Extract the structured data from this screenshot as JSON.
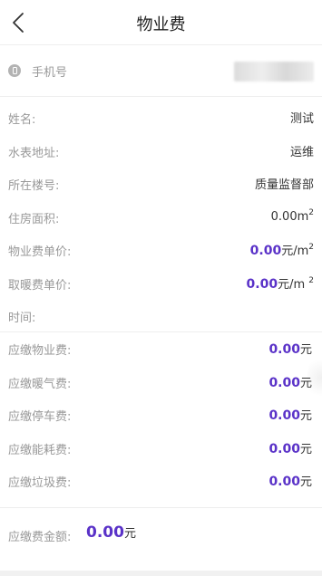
{
  "header": {
    "title": "物业费",
    "back_icon": "chevron-left-icon"
  },
  "phone": {
    "label": "手机号",
    "icon": "phone-icon",
    "value_redacted": true
  },
  "info": {
    "name": {
      "label": "姓名:",
      "value": "测试"
    },
    "meter_address": {
      "label": "水表地址:",
      "value": "运维"
    },
    "building": {
      "label": "所在楼号:",
      "value": "质量监督部"
    },
    "area": {
      "label": "住房面积:",
      "value": "0.00m",
      "sup": "2"
    },
    "property_unit_price": {
      "label": "物业费单价:",
      "amount": "0.00",
      "unit": "元/m",
      "sup": "2"
    },
    "heating_unit_price": {
      "label": "取暖费单价:",
      "amount": "0.00",
      "unit": "元/m ",
      "sup": "2"
    },
    "time": {
      "label": "时间:"
    }
  },
  "fees": [
    {
      "label": "应缴物业费:",
      "amount": "0.00",
      "unit": "元"
    },
    {
      "label": "应缴暖气费:",
      "amount": "0.00",
      "unit": "元"
    },
    {
      "label": "应缴停车费:",
      "amount": "0.00",
      "unit": "元"
    },
    {
      "label": "应缴能耗费:",
      "amount": "0.00",
      "unit": "元"
    },
    {
      "label": "应缴垃圾费:",
      "amount": "0.00",
      "unit": "元"
    }
  ],
  "total": {
    "label": "应缴费金额:",
    "amount": "0.00",
    "unit": "元"
  },
  "colors": {
    "accent": "#5a32c8",
    "label": "#999999",
    "text": "#333333",
    "divider": "#eeeeee"
  }
}
